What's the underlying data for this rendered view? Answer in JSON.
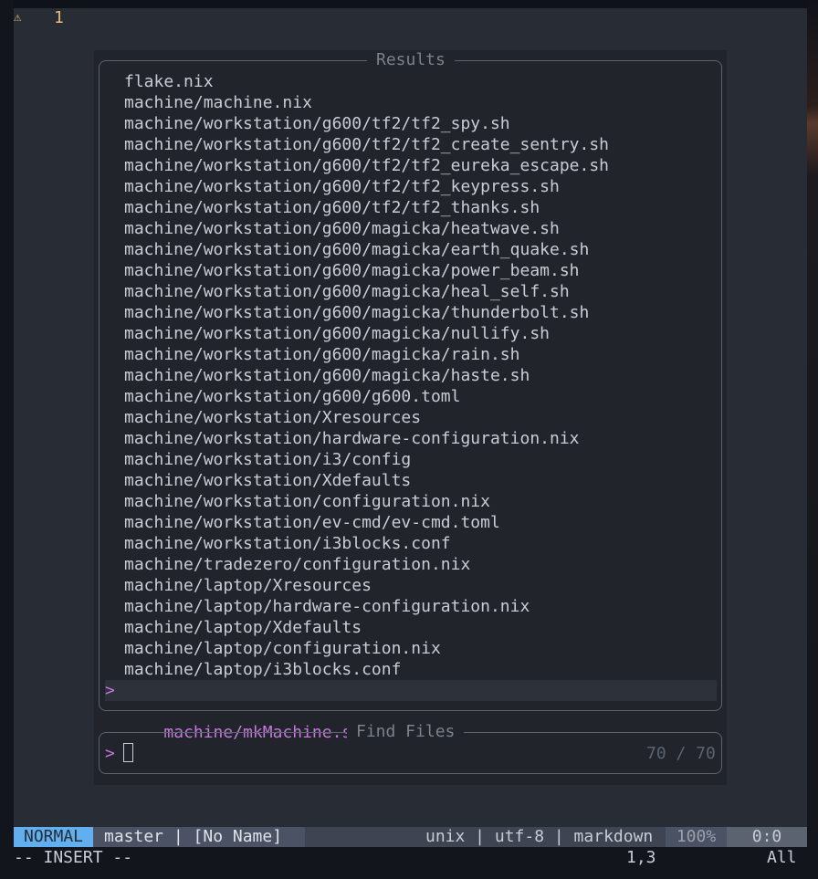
{
  "gutter": {
    "warning_icon": "⚠",
    "line_number": "1"
  },
  "results": {
    "title": "Results",
    "items": [
      "flake.nix",
      "machine/machine.nix",
      "machine/workstation/g600/tf2/tf2_spy.sh",
      "machine/workstation/g600/tf2/tf2_create_sentry.sh",
      "machine/workstation/g600/tf2/tf2_eureka_escape.sh",
      "machine/workstation/g600/tf2/tf2_keypress.sh",
      "machine/workstation/g600/tf2/tf2_thanks.sh",
      "machine/workstation/g600/magicka/heatwave.sh",
      "machine/workstation/g600/magicka/earth_quake.sh",
      "machine/workstation/g600/magicka/power_beam.sh",
      "machine/workstation/g600/magicka/heal_self.sh",
      "machine/workstation/g600/magicka/thunderbolt.sh",
      "machine/workstation/g600/magicka/nullify.sh",
      "machine/workstation/g600/magicka/rain.sh",
      "machine/workstation/g600/magicka/haste.sh",
      "machine/workstation/g600/g600.toml",
      "machine/workstation/Xresources",
      "machine/workstation/hardware-configuration.nix",
      "machine/workstation/i3/config",
      "machine/workstation/Xdefaults",
      "machine/workstation/configuration.nix",
      "machine/workstation/ev-cmd/ev-cmd.toml",
      "machine/workstation/i3blocks.conf",
      "machine/tradezero/configuration.nix",
      "machine/laptop/Xresources",
      "machine/laptop/hardware-configuration.nix",
      "machine/laptop/Xdefaults",
      "machine/laptop/configuration.nix",
      "machine/laptop/i3blocks.conf"
    ],
    "selected_caret": ">",
    "selected_item": "machine/mkMachine.sh"
  },
  "prompt": {
    "title": "Find Files",
    "caret": ">",
    "input_value": "",
    "count": "70 / 70"
  },
  "statusline": {
    "mode": "NORMAL",
    "branch_file": "master | [No Name]",
    "file_info": "unix | utf-8 | markdown",
    "percent": "100%",
    "position": "0:0"
  },
  "cmdline": {
    "mode_text": "-- INSERT --",
    "ruler": "1,3",
    "scroll": "All"
  },
  "colors": {
    "background": "#282c34",
    "accent_purple": "#c678dd",
    "mode_blue": "#61afef",
    "warning_yellow": "#e5c07b"
  }
}
